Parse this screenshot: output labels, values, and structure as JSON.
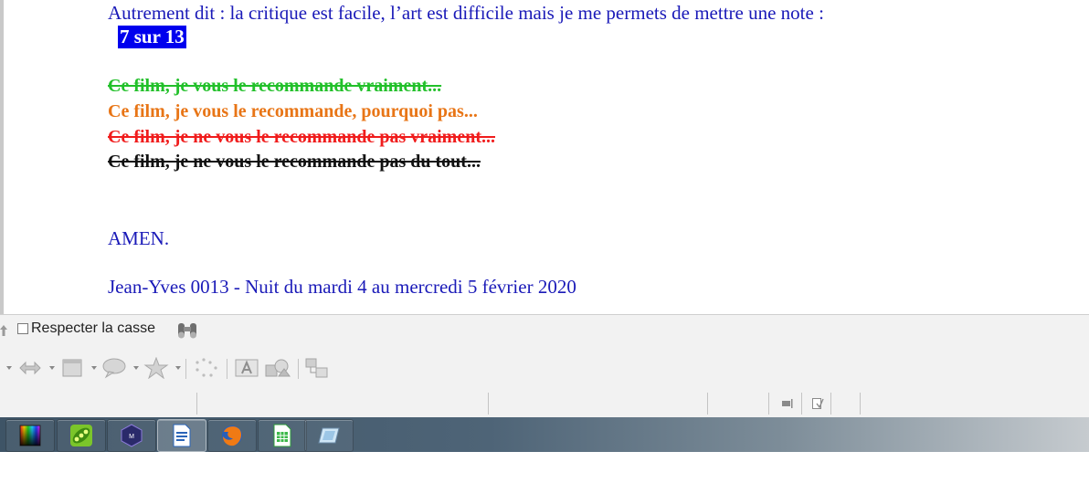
{
  "document": {
    "intro_line": "Autrement dit : la critique est facile, l’art est difficile mais je me permets de mettre une note :",
    "note": "7  sur 13",
    "recommendations": [
      {
        "text": "Ce film, je vous le recommande vraiment...",
        "color": "#22c02a",
        "strikethrough": true
      },
      {
        "text": "Ce film, je vous le recommande, pourquoi  pas...",
        "color": "#e87516",
        "strikethrough": false
      },
      {
        "text": "Ce film, je ne vous le recommande pas vraiment...",
        "color": "#f01c1c",
        "strikethrough": true
      },
      {
        "text": "Ce film, je ne vous le recommande pas du tout...",
        "color": "#111111",
        "strikethrough": true
      }
    ],
    "amen": "AMEN.",
    "signature": "Jean-Yves 0013  -  Nuit du mardi 4  au mercredi 5 février 2020",
    "text_color": "#1a1ab8",
    "highlight_color": "#0000ee"
  },
  "find_toolbar": {
    "match_case_label": "Respecter la casse",
    "match_case_checked": false,
    "icons": [
      "up-arrow-icon",
      "binoculars-icon"
    ]
  },
  "drawing_toolbar": {
    "icons": [
      "arrows-icon",
      "rectangle-icon",
      "callout-icon",
      "star-icon",
      "points-icon",
      "fontwork-icon",
      "shapes-icon",
      "group-icon"
    ]
  },
  "taskbar": {
    "apps": [
      "color-picker-icon",
      "pea-app-icon",
      "media-app-icon",
      "writer-icon",
      "firefox-icon",
      "calc-icon",
      "flat-app-icon"
    ],
    "active_app": "writer-icon"
  }
}
